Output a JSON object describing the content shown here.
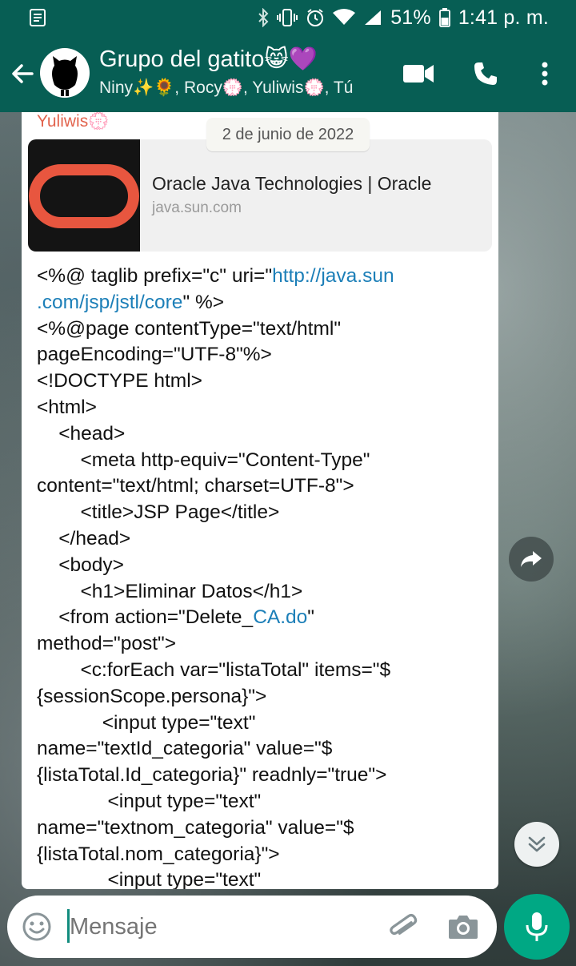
{
  "status_bar": {
    "battery_percent": "51%",
    "time": "1:41 p. m.",
    "icons": [
      "notification-icon",
      "bluetooth-icon",
      "vibrate-icon",
      "alarm-icon",
      "wifi-icon",
      "signal-icon",
      "battery-icon"
    ]
  },
  "header": {
    "title": "Grupo del gatito😸💜",
    "subtitle": "Niny✨🌻, Rocy💮, Yuliwis💮, Tú",
    "icons": [
      "back-arrow-icon",
      "group-avatar",
      "video-call-icon",
      "phone-icon",
      "more-options-icon"
    ]
  },
  "date_chip": "2 de junio de 2022",
  "message": {
    "sender": "Yuliwis💮",
    "link_preview": {
      "title": "Oracle Java Technologies | Oracle",
      "domain": "java.sun.com"
    },
    "lines": [
      {
        "parts": [
          {
            "t": "<%@ taglib prefix=\"c\" uri=\""
          },
          {
            "t": "http://java.sun",
            "link": true
          }
        ]
      },
      {
        "parts": [
          {
            "t": ".com/jsp/jstl/core",
            "link": true
          },
          {
            "t": "\" %>"
          }
        ]
      },
      {
        "parts": [
          {
            "t": "<%@page contentType=\"text/html\""
          }
        ]
      },
      {
        "parts": [
          {
            "t": "pageEncoding=\"UTF-8\"%>"
          }
        ]
      },
      {
        "parts": [
          {
            "t": "<!DOCTYPE html>"
          }
        ]
      },
      {
        "parts": [
          {
            "t": "<html>"
          }
        ]
      },
      {
        "parts": [
          {
            "t": "    <head>"
          }
        ]
      },
      {
        "parts": [
          {
            "t": "        <meta http-equiv=\"Content-Type\""
          }
        ]
      },
      {
        "parts": [
          {
            "t": "content=\"text/html; charset=UTF-8\">"
          }
        ]
      },
      {
        "parts": [
          {
            "t": "        <title>JSP Page</title>"
          }
        ]
      },
      {
        "parts": [
          {
            "t": "    </head>"
          }
        ]
      },
      {
        "parts": [
          {
            "t": "    <body>"
          }
        ]
      },
      {
        "parts": [
          {
            "t": "        <h1>Eliminar Datos</h1>"
          }
        ]
      },
      {
        "parts": [
          {
            "t": "    <from action=\"Delete_"
          },
          {
            "t": "CA.do",
            "link": true
          },
          {
            "t": "\""
          }
        ]
      },
      {
        "parts": [
          {
            "t": "method=\"post\">"
          }
        ]
      },
      {
        "parts": [
          {
            "t": "        <c:forEach var=\"listaTotal\" items=\"$"
          }
        ]
      },
      {
        "parts": [
          {
            "t": "{sessionScope.persona}\">"
          }
        ]
      },
      {
        "parts": [
          {
            "t": "            <input type=\"text\""
          }
        ]
      },
      {
        "parts": [
          {
            "t": "name=\"textId_categoria\" value=\"$"
          }
        ]
      },
      {
        "parts": [
          {
            "t": "{listaTotal.Id_categoria}\" readnly=\"true\">"
          }
        ]
      },
      {
        "parts": [
          {
            "t": "             <input type=\"text\""
          }
        ]
      },
      {
        "parts": [
          {
            "t": "name=\"textnom_categoria\" value=\"$"
          }
        ]
      },
      {
        "parts": [
          {
            "t": "{listaTotal.nom_categoria}\">"
          }
        ]
      },
      {
        "parts": [
          {
            "t": "             <input type=\"text\""
          }
        ]
      }
    ]
  },
  "input": {
    "placeholder": "Mensaje",
    "icons": [
      "emoji-icon",
      "attach-clip-icon",
      "camera-icon",
      "microphone-icon"
    ]
  },
  "floating": {
    "icons": [
      "forward-icon",
      "scroll-down-icon"
    ]
  },
  "colors": {
    "header_green": "#075e54",
    "accent_green": "#00a884",
    "sender_color": "#e2644e",
    "link_color": "#1c7fb8",
    "oracle_red": "#e8563f"
  }
}
